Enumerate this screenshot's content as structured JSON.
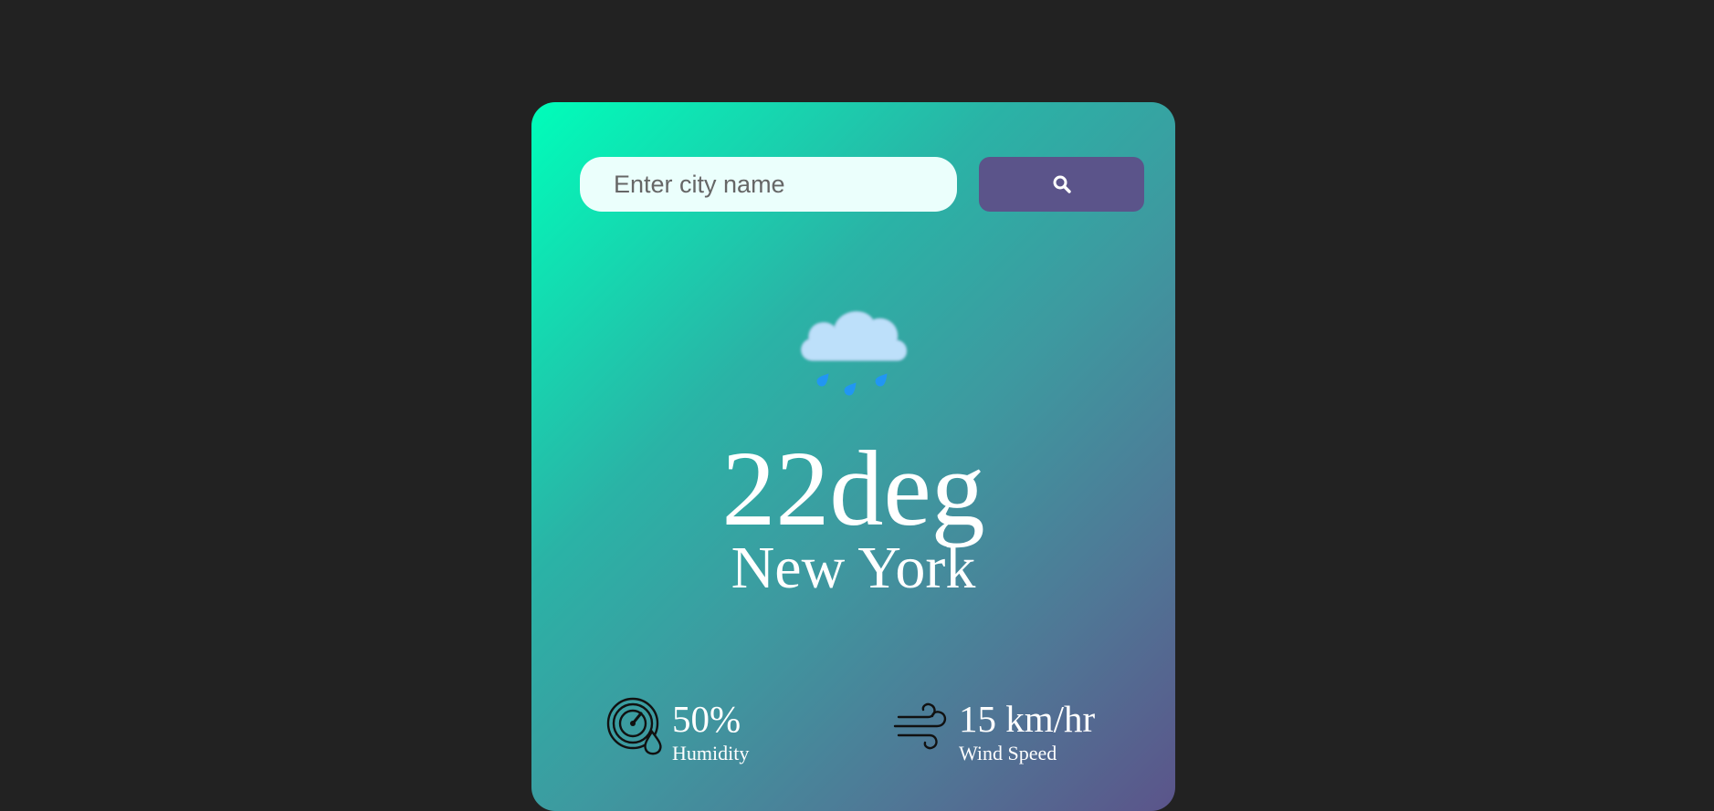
{
  "search": {
    "placeholder": "Enter city name",
    "value": "",
    "button_icon": "search-icon"
  },
  "weather": {
    "icon": "rain-cloud-icon",
    "temperature": "22deg",
    "city": "New York"
  },
  "details": {
    "humidity": {
      "icon": "humidity-gauge-icon",
      "value": "50%",
      "label": "Humidity"
    },
    "wind": {
      "icon": "wind-icon",
      "value": "15 km/hr",
      "label": "Wind Speed"
    }
  },
  "colors": {
    "page_background": "#222222",
    "gradient_start": "#00feba",
    "gradient_end": "#5b548a",
    "button": "#5b548a",
    "input_background": "#ebfffc",
    "text": "#ffffff"
  }
}
